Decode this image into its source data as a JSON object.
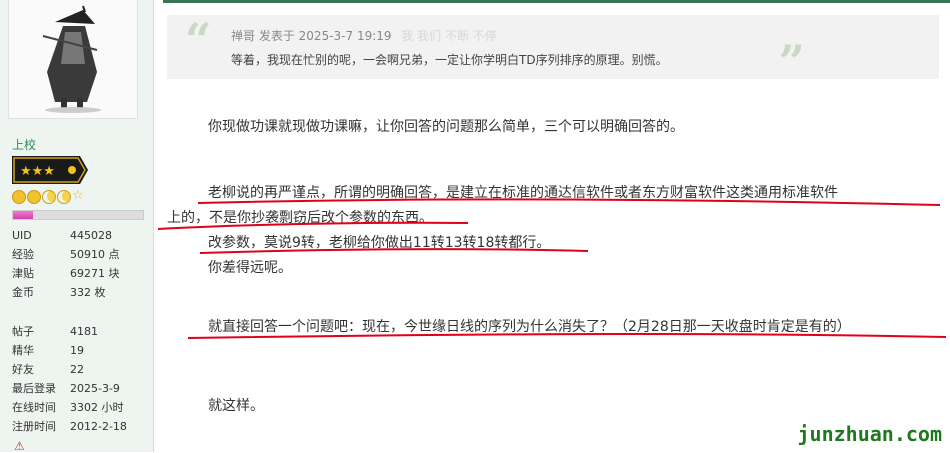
{
  "sidebar": {
    "rank_title": "上校",
    "progress_fraction": 0.15,
    "stats_top": [
      {
        "key": "UID",
        "value": "445028"
      },
      {
        "key": "经验",
        "value": "50910 点"
      },
      {
        "key": "津贴",
        "value": "69271 块"
      },
      {
        "key": "金币",
        "value": "332 枚"
      }
    ],
    "stats_bottom": [
      {
        "key": "帖子",
        "value": "4181"
      },
      {
        "key": "精华",
        "value": "19"
      },
      {
        "key": "好友",
        "value": "22"
      },
      {
        "key": "最后登录",
        "value": "2025-3-9"
      },
      {
        "key": "在线时间",
        "value": "3302 小时"
      },
      {
        "key": "注册时间",
        "value": "2012-2-18"
      }
    ]
  },
  "quote": {
    "author": "禅哥",
    "posted_label": "发表于 2025-3-7 19:19",
    "ghost_text": "我 我们 不断 不停",
    "text": "等着，我现在忙别的呢，一会啊兄弟，一定让你学明白TD序列排序的原理。别慌。"
  },
  "post": {
    "p1": "你现做功课就现做功课嘛，让你回答的问题那么简单，三个可以明确回答的。",
    "p2_line1": "老柳说的再严谨点，所谓的明确回答，是建立在标准的通达信软件或者东方财富软件这类通用标准软件",
    "p2_line2": "上的，不是你抄袭剽窃后改个参数的东西。",
    "p2_line3": "改参数，莫说9转，老柳给你做出11转13转18转都行。",
    "p2_line4": "你差得远呢。",
    "p3": "就直接回答一个问题吧：现在，今世缘日线的序列为什么消失了？（2月28日那一天收盘时肯定是有的）",
    "p4": "就这样。"
  },
  "watermark": "junzhuan.com",
  "colors": {
    "header_bar": "#3a7450",
    "sidebar_bg": "#eef4ef",
    "rank_title": "#2e8b57",
    "underline": "#e0001a",
    "watermark": "#1f7a1f"
  }
}
